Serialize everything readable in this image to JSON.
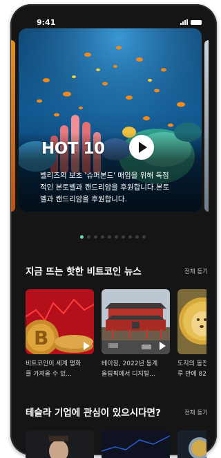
{
  "status_bar": {
    "time": "9:41"
  },
  "hero": {
    "title": "HOT 10",
    "description_lines": [
      "벨리즈의 보초 '슈퍼본드' 매입을 위해 독점",
      "적인 본토벨과 캔드리암을 후원합니다.본토",
      "벨과 캔드리암을 후원합니다."
    ],
    "page_count": 10,
    "active_page": 0
  },
  "bitcoin_news": {
    "title": "지금 뜨는 핫한 비트코인 뉴스",
    "see_all": "전체 듣기",
    "items": [
      {
        "caption_lines": [
          "비트코인이 세계 평화",
          "를 가져올 수 있..."
        ],
        "image": "bitcoin-coins"
      },
      {
        "caption_lines": [
          "베이징, 2022년 동계",
          "올림픽에서 디지털..."
        ],
        "image": "tiananmen-gate"
      },
      {
        "caption_lines": [
          "도지의 동전",
          "루 만에 82%"
        ],
        "image": "dogecoin"
      }
    ]
  },
  "tesla_section": {
    "title": "테슬라 기업에 관심이 있으시다면?",
    "see_all": "전체 듣기"
  },
  "colors": {
    "background": "#151516",
    "dot_active": "#6fd6b4",
    "dot_inactive": "#3d3d40"
  }
}
